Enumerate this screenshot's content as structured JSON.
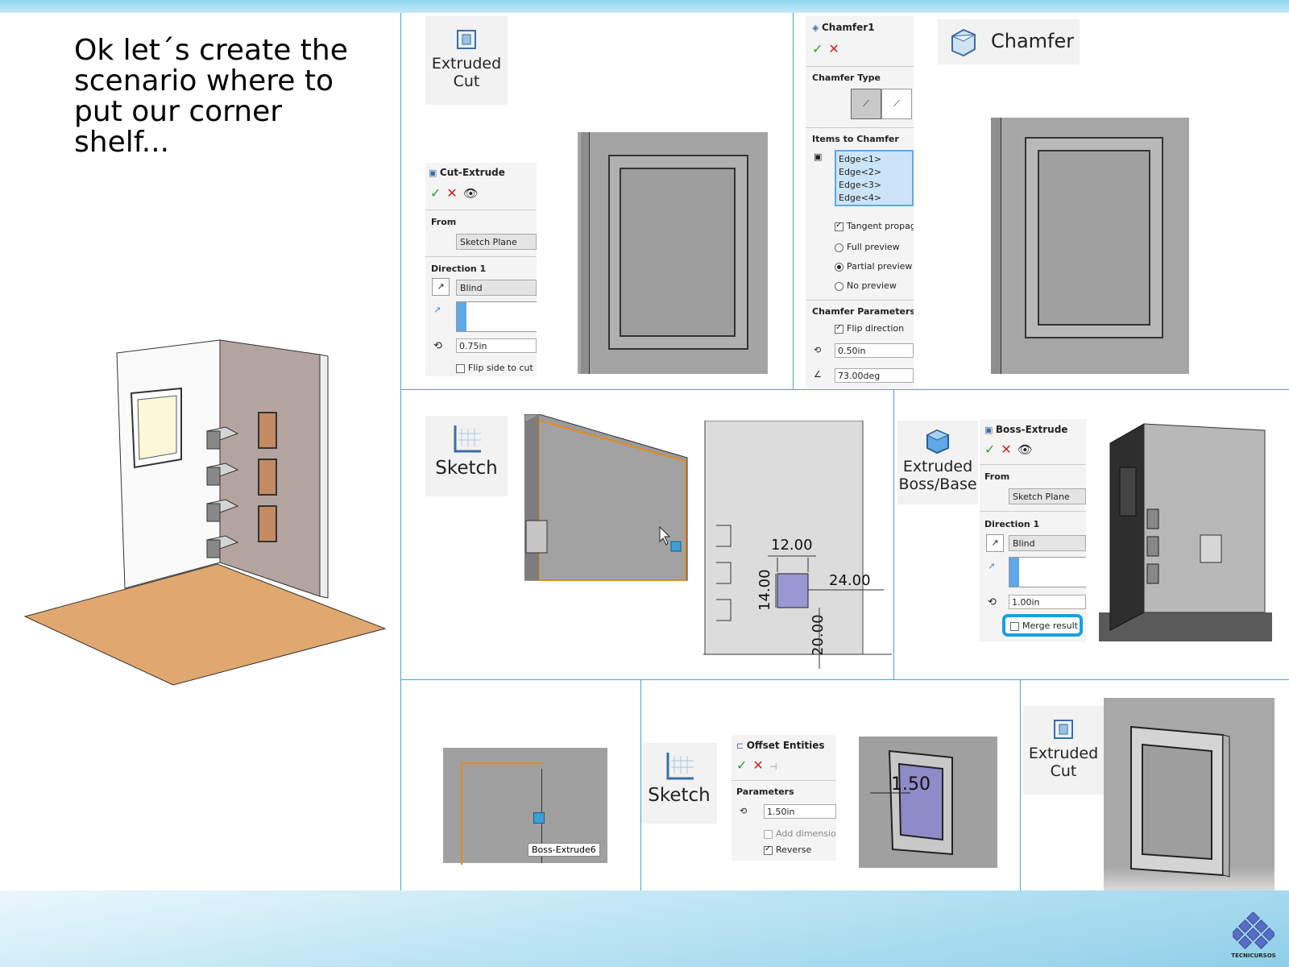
{
  "heading": "Ok let´s create the scenario where to put our corner shelf...",
  "logo_text": "TECNICURSOS",
  "tools": {
    "extruded_cut_1": "Extruded Cut",
    "chamfer_tool": "Chamfer",
    "sketch_1": "Sketch",
    "extruded_boss": "Extruded Boss/Base",
    "sketch_2": "Sketch",
    "extruded_cut_2": "Extruded Cut"
  },
  "cut_extrude": {
    "title": "Cut-Extrude",
    "from_label": "From",
    "from_value": "Sketch Plane",
    "direction_label": "Direction 1",
    "end_condition": "Blind",
    "depth": "0.75in",
    "flip_label": "Flip side to cut"
  },
  "chamfer": {
    "title": "Chamfer1",
    "type_label": "Chamfer Type",
    "items_label": "Items to Chamfer",
    "edges": [
      "Edge<1>",
      "Edge<2>",
      "Edge<3>",
      "Edge<4>"
    ],
    "tangent": "Tangent propag",
    "full_preview": "Full preview",
    "partial_preview": "Partial preview",
    "no_preview": "No preview",
    "params_label": "Chamfer Parameters",
    "flip": "Flip direction",
    "distance": "0.50in",
    "angle": "73.00deg"
  },
  "sketch_dims": {
    "d1": "12.00",
    "d2": "24.00",
    "d3": "14.00",
    "d4": "20.00"
  },
  "boss_extrude": {
    "title": "Boss-Extrude",
    "from_label": "From",
    "from_value": "Sketch Plane",
    "direction_label": "Direction 1",
    "end_condition": "Blind",
    "depth": "1.00in",
    "merge": "Merge result"
  },
  "tooltip": "Boss-Extrude6",
  "offset": {
    "title": "Offset Entities",
    "params_label": "Parameters",
    "distance": "1.50in",
    "add_dims": "Add dimension",
    "reverse": "Reverse",
    "dim_value": "1.50"
  },
  "colors": {
    "accent": "#4aa4cc",
    "floor": "#e0a86e",
    "wall": "#b4a4a0",
    "highlight": "#1aa0e0"
  }
}
